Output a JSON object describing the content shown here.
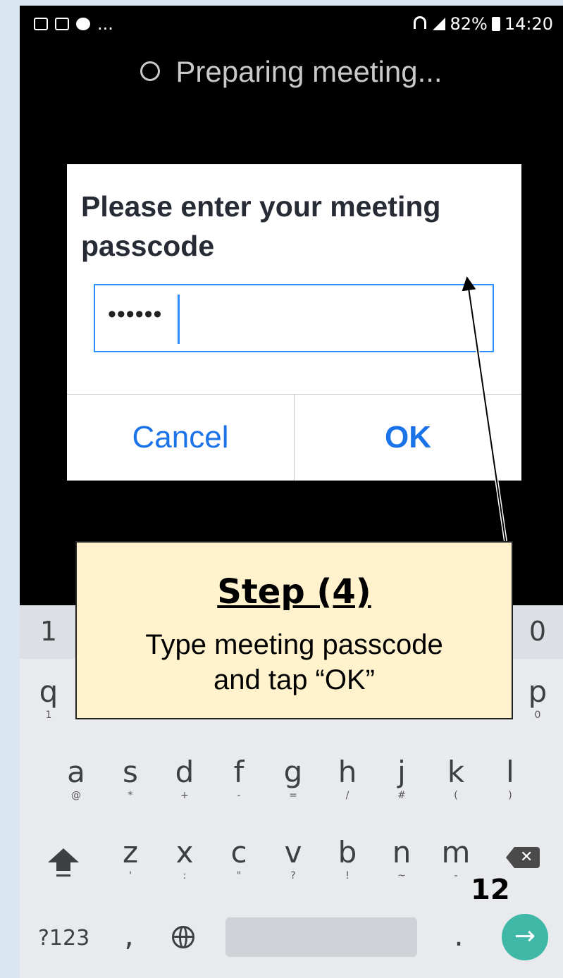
{
  "status_bar": {
    "left_icons": [
      "image-icon",
      "laz-app-icon",
      "chat-icon"
    ],
    "more": "...",
    "battery": "82%",
    "time": "14:20"
  },
  "app": {
    "preparing_text": "Preparing meeting..."
  },
  "dialog": {
    "title": "Please enter your meeting passcode",
    "passcode_value": "••••••",
    "cancel_label": "Cancel",
    "ok_label": "OK"
  },
  "keyboard": {
    "number_row_visible": {
      "left": "1",
      "right": "0"
    },
    "row1_visible": [
      {
        "key": "q",
        "sub": "1"
      },
      {
        "key": "p",
        "sub": "0"
      }
    ],
    "row2": [
      {
        "key": "a",
        "sub": "@"
      },
      {
        "key": "s",
        "sub": "*"
      },
      {
        "key": "d",
        "sub": "+"
      },
      {
        "key": "f",
        "sub": "-"
      },
      {
        "key": "g",
        "sub": "="
      },
      {
        "key": "h",
        "sub": "/"
      },
      {
        "key": "j",
        "sub": "#"
      },
      {
        "key": "k",
        "sub": "("
      },
      {
        "key": "l",
        "sub": ")"
      }
    ],
    "row3": [
      {
        "key": "z",
        "sub": "'"
      },
      {
        "key": "x",
        "sub": ":"
      },
      {
        "key": "c",
        "sub": "\""
      },
      {
        "key": "v",
        "sub": "?"
      },
      {
        "key": "b",
        "sub": "!"
      },
      {
        "key": "n",
        "sub": "~"
      },
      {
        "key": "m",
        "sub": "-"
      }
    ],
    "bottom": {
      "symbols_label": "?123",
      "comma": ",",
      "period": ".",
      "enter_icon": "arrow-right-icon"
    }
  },
  "callout": {
    "title": "Step (4)",
    "body_line1": "Type meeting passcode",
    "body_line2": "and tap “OK”"
  },
  "page_number": "12",
  "colors": {
    "accent": "#2d8cff",
    "callout_bg": "#fff2cc",
    "enter_key": "#3fb8a7"
  }
}
